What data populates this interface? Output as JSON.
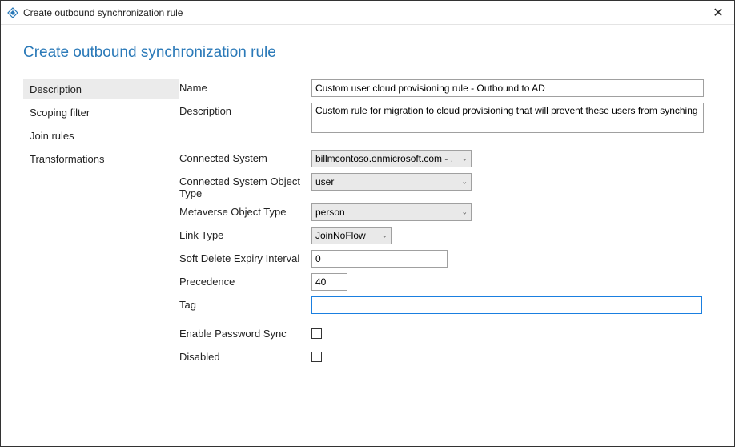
{
  "titlebar": {
    "title": "Create outbound synchronization rule"
  },
  "heading": "Create outbound synchronization rule",
  "sidebar": {
    "items": [
      {
        "label": "Description",
        "active": true
      },
      {
        "label": "Scoping filter",
        "active": false
      },
      {
        "label": "Join rules",
        "active": false
      },
      {
        "label": "Transformations",
        "active": false
      }
    ]
  },
  "form": {
    "name": {
      "label": "Name",
      "value": "Custom user cloud provisioning rule - Outbound to AD"
    },
    "description": {
      "label": "Description",
      "value": "Custom rule for migration to cloud provisioning that will prevent these users from synching"
    },
    "connected_system": {
      "label": "Connected System",
      "value": "billmcontoso.onmicrosoft.com - ."
    },
    "cs_object_type": {
      "label": "Connected System Object Type",
      "value": "user"
    },
    "mv_object_type": {
      "label": "Metaverse Object Type",
      "value": "person"
    },
    "link_type": {
      "label": "Link Type",
      "value": "JoinNoFlow"
    },
    "soft_delete": {
      "label": "Soft Delete Expiry Interval",
      "value": "0"
    },
    "precedence": {
      "label": "Precedence",
      "value": "40"
    },
    "tag": {
      "label": "Tag",
      "value": ""
    },
    "enable_pw_sync": {
      "label": "Enable Password Sync"
    },
    "disabled": {
      "label": "Disabled"
    }
  }
}
